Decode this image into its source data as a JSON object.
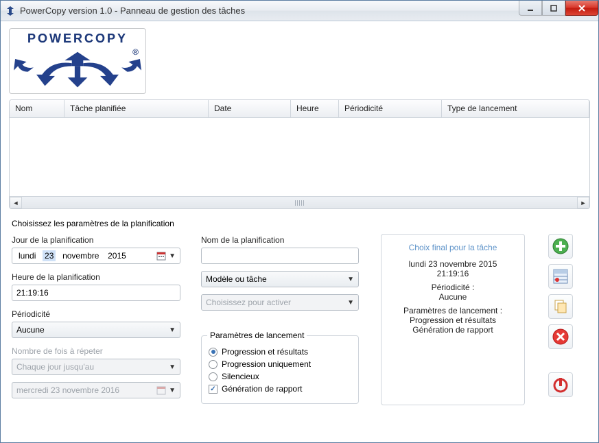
{
  "window": {
    "title": "PowerCopy version 1.0 - Panneau de gestion des tâches"
  },
  "logo": {
    "text": "POWERCOPY"
  },
  "table": {
    "columns": {
      "nom": "Nom",
      "tache": "Tâche planifiée",
      "date": "Date",
      "heure": "Heure",
      "periodicite": "Périodicité",
      "type": "Type de lancement"
    }
  },
  "section_title": "Choisissez les paramètres de la planification",
  "left": {
    "jour_label": "Jour de la planification",
    "jour_value_dow": "lundi",
    "jour_value_day": "23",
    "jour_value_month": "novembre",
    "jour_value_year": "2015",
    "heure_label": "Heure de la planification",
    "heure_value": "21:19:16",
    "periodicite_label": "Périodicité",
    "periodicite_value": "Aucune",
    "repeat_label": "Nombre de fois à répeter",
    "repeat_value": "Chaque jour jusqu'au",
    "until_value": "mercredi 23 novembre 2016"
  },
  "mid": {
    "nom_label": "Nom de la planification",
    "nom_value": "",
    "modele_placeholder": "Modèle ou tâche",
    "activer_placeholder": "Choisissez pour activer",
    "launch_legend": "Paramètres de lancement",
    "opt_prog_res": "Progression et résultats",
    "opt_prog_only": "Progression uniquement",
    "opt_silent": "Silencieux",
    "opt_report": "Génération de rapport"
  },
  "summary": {
    "head": "Choix final pour la tâche",
    "date": "lundi 23 novembre 2015",
    "time": "21:19:16",
    "period_label": "Périodicité :",
    "period_value": "Aucune",
    "launch_label": "Paramètres de lancement :",
    "launch_line1": "Progression et résultats",
    "launch_line2": "Génération de rapport"
  }
}
